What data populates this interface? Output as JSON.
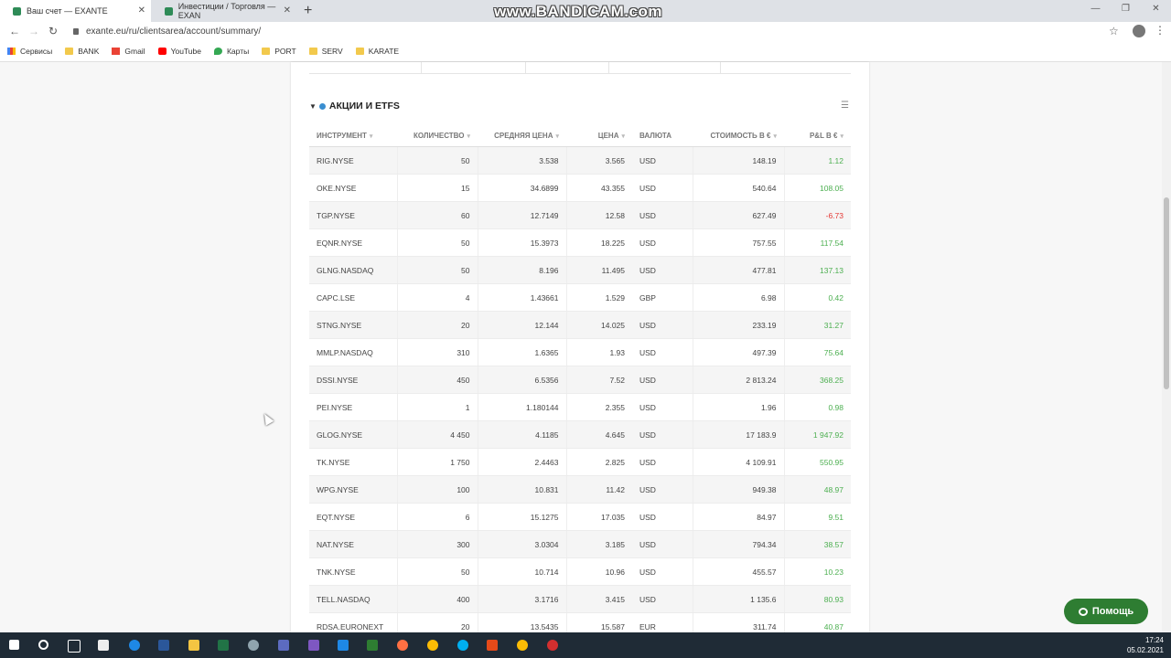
{
  "browser": {
    "tabs": [
      {
        "title": "Ваш счет — EXANTE",
        "close": "✕"
      },
      {
        "title": "Инвестиции / Торговля — EXAN",
        "close": "✕"
      }
    ],
    "new_tab": "+",
    "watermark": "www.BANDICAM.com",
    "window_controls": [
      "—",
      "❐",
      "✕"
    ],
    "url": "exante.eu/ru/clientsarea/account/summary/",
    "bookmarks": [
      "Сервисы",
      "BANK",
      "Gmail",
      "YouTube",
      "Карты",
      "PORT",
      "SERV",
      "KARATE"
    ]
  },
  "section": {
    "title": "АКЦИИ И ETFS"
  },
  "table": {
    "headers": [
      "ИНСТРУМЕНТ",
      "КОЛИЧЕСТВО",
      "СРЕДНЯЯ ЦЕНА",
      "ЦЕНА",
      "ВАЛЮТА",
      "СТОИМОСТЬ В €",
      "P&L В €"
    ],
    "rows": [
      [
        "RIG.NYSE",
        "50",
        "3.538",
        "3.565",
        "USD",
        "148.19",
        "1.12"
      ],
      [
        "OKE.NYSE",
        "15",
        "34.6899",
        "43.355",
        "USD",
        "540.64",
        "108.05"
      ],
      [
        "TGP.NYSE",
        "60",
        "12.7149",
        "12.58",
        "USD",
        "627.49",
        "-6.73"
      ],
      [
        "EQNR.NYSE",
        "50",
        "15.3973",
        "18.225",
        "USD",
        "757.55",
        "117.54"
      ],
      [
        "GLNG.NASDAQ",
        "50",
        "8.196",
        "11.495",
        "USD",
        "477.81",
        "137.13"
      ],
      [
        "CAPC.LSE",
        "4",
        "1.43661",
        "1.529",
        "GBP",
        "6.98",
        "0.42"
      ],
      [
        "STNG.NYSE",
        "20",
        "12.144",
        "14.025",
        "USD",
        "233.19",
        "31.27"
      ],
      [
        "MMLP.NASDAQ",
        "310",
        "1.6365",
        "1.93",
        "USD",
        "497.39",
        "75.64"
      ],
      [
        "DSSI.NYSE",
        "450",
        "6.5356",
        "7.52",
        "USD",
        "2 813.24",
        "368.25"
      ],
      [
        "PEI.NYSE",
        "1",
        "1.180144",
        "2.355",
        "USD",
        "1.96",
        "0.98"
      ],
      [
        "GLOG.NYSE",
        "4 450",
        "4.1185",
        "4.645",
        "USD",
        "17 183.9",
        "1 947.92"
      ],
      [
        "TK.NYSE",
        "1 750",
        "2.4463",
        "2.825",
        "USD",
        "4 109.91",
        "550.95"
      ],
      [
        "WPG.NYSE",
        "100",
        "10.831",
        "11.42",
        "USD",
        "949.38",
        "48.97"
      ],
      [
        "EQT.NYSE",
        "6",
        "15.1275",
        "17.035",
        "USD",
        "84.97",
        "9.51"
      ],
      [
        "NAT.NYSE",
        "300",
        "3.0304",
        "3.185",
        "USD",
        "794.34",
        "38.57"
      ],
      [
        "TNK.NYSE",
        "50",
        "10.714",
        "10.96",
        "USD",
        "455.57",
        "10.23"
      ],
      [
        "TELL.NASDAQ",
        "400",
        "3.1716",
        "3.415",
        "USD",
        "1 135.6",
        "80.93"
      ],
      [
        "RDSA.EURONEXT",
        "20",
        "13.5435",
        "15.587",
        "EUR",
        "311.74",
        "40.87"
      ]
    ]
  },
  "help_button": "Помощь",
  "clock": {
    "time": "17:24",
    "date": "05.02.2021"
  },
  "colors": {
    "positive": "#4caf50",
    "negative": "#e53935",
    "help_bg": "#2e7d32",
    "section_dot": "#3a8ed0"
  }
}
